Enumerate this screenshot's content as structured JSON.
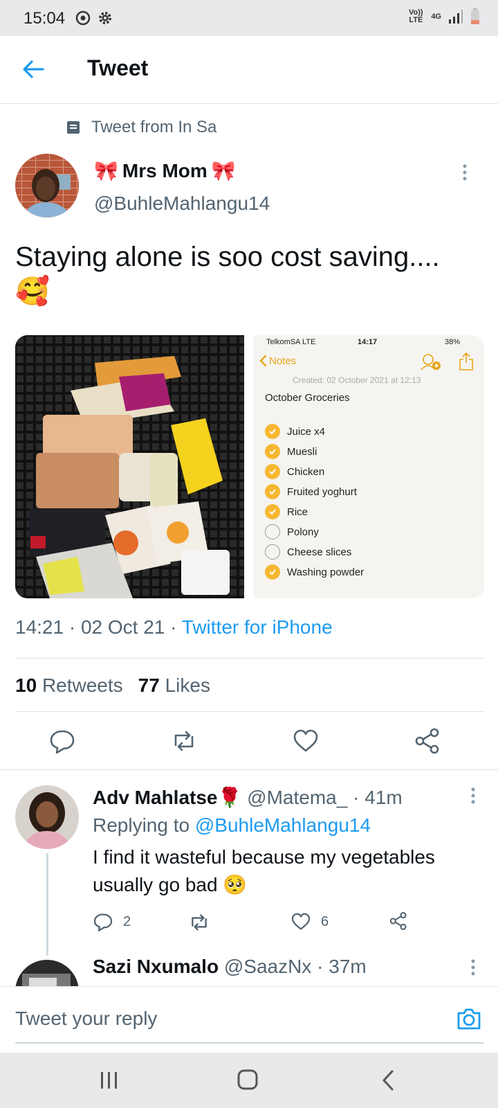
{
  "status_bar": {
    "time": "15:04",
    "volte": "Vo)) LTE",
    "network": "4G"
  },
  "header": {
    "title": "Tweet"
  },
  "context": {
    "text": "Tweet from In Sa"
  },
  "tweet": {
    "author_name": "Mrs Mom",
    "author_emoji_left": "🎀",
    "author_emoji_right": "🎀",
    "author_handle": "@BuhleMahlangu14",
    "text": "Staying alone is soo cost saving....",
    "emoji": "🥰",
    "time": "14:21",
    "date": "02 Oct 21",
    "source": "Twitter for iPhone",
    "retweets_count": "10",
    "retweets_label": "Retweets",
    "likes_count": "77",
    "likes_label": "Likes"
  },
  "notes_screenshot": {
    "carrier": "TelkomSA  LTE",
    "time": "14:17",
    "battery": "38%",
    "back_label": "Notes",
    "created": "Created: 02 October 2021 at 12:13",
    "title": "October Groceries",
    "items": [
      {
        "label": "Juice x4",
        "checked": true
      },
      {
        "label": "Muesli",
        "checked": true
      },
      {
        "label": "Chicken",
        "checked": true
      },
      {
        "label": "Fruited yoghurt",
        "checked": true
      },
      {
        "label": "Rice",
        "checked": true
      },
      {
        "label": "Polony",
        "checked": false
      },
      {
        "label": "Cheese slices",
        "checked": false
      },
      {
        "label": "Washing powder",
        "checked": true
      }
    ]
  },
  "replies": [
    {
      "name": "Adv Mahlatse",
      "name_emoji": "🌹",
      "handle": "@Matema_",
      "age": "· 41m",
      "replying_prefix": "Replying to",
      "replying_to": "@BuhleMahlangu14",
      "text": "I find it wasteful because my vegetables usually go bad",
      "text_emoji": "🥺",
      "reply_count": "2",
      "like_count": "6"
    },
    {
      "name": "Sazi Nxumalo",
      "handle": "@SaazNx",
      "age": "· 37m"
    }
  ],
  "composer": {
    "placeholder": "Tweet your reply"
  },
  "colors": {
    "accent": "#1d9bf0",
    "secondary_text": "#536471",
    "notes_yellow": "#f7b731"
  }
}
